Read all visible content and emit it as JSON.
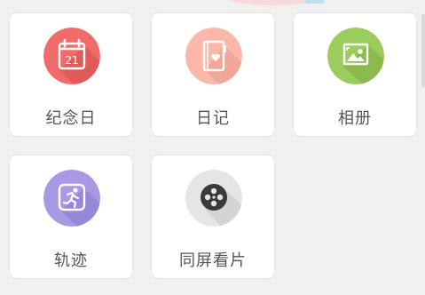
{
  "grid": {
    "tiles": [
      {
        "label": "纪念日",
        "icon": "calendar-icon",
        "color": "#f26b6b",
        "calendar_day": "21"
      },
      {
        "label": "日记",
        "icon": "diary-icon",
        "color": "#f9b8aa"
      },
      {
        "label": "相册",
        "icon": "photo-album-icon",
        "color": "#9ccb5e"
      },
      {
        "label": "轨迹",
        "icon": "running-person-icon",
        "color": "#a999e4"
      },
      {
        "label": "同屏看片",
        "icon": "film-reel-icon",
        "color": "#e5e5e5"
      }
    ]
  }
}
